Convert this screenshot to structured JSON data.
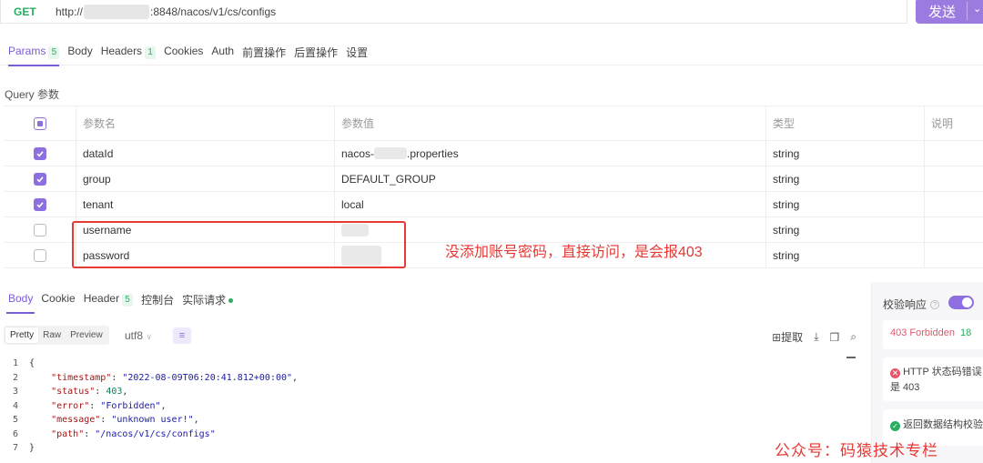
{
  "request": {
    "method": "GET",
    "url_prefix": "http://",
    "url_suffix": ":8848/nacos/v1/cs/configs",
    "send_label": "发送",
    "send_chevron": "⌄"
  },
  "req_tabs": [
    {
      "label": "Params",
      "badge": "5"
    },
    {
      "label": "Body",
      "badge": ""
    },
    {
      "label": "Headers",
      "badge": "1"
    },
    {
      "label": "Cookies",
      "badge": ""
    },
    {
      "label": "Auth",
      "badge": ""
    },
    {
      "label": "前置操作",
      "badge": ""
    },
    {
      "label": "后置操作",
      "badge": ""
    },
    {
      "label": "设置",
      "badge": ""
    }
  ],
  "query_label": "Query 参数",
  "params": {
    "headers": {
      "name": "参数名",
      "value": "参数值",
      "type": "类型",
      "desc": "说明"
    },
    "rows": [
      {
        "checked": true,
        "name": "dataId",
        "value_prefix": "nacos-",
        "value_suffix": ".properties",
        "type": "string"
      },
      {
        "checked": true,
        "name": "group",
        "value_prefix": "DEFAULT_GROUP",
        "value_suffix": "",
        "type": "string"
      },
      {
        "checked": true,
        "name": "tenant",
        "value_prefix": "local",
        "value_suffix": "",
        "type": "string"
      },
      {
        "checked": false,
        "name": "username",
        "value_prefix": "",
        "value_suffix": "",
        "type": "string"
      },
      {
        "checked": false,
        "name": "password",
        "value_prefix": "",
        "value_suffix": "",
        "type": "string"
      }
    ]
  },
  "annotation": "没添加账号密码，直接访问，是会报403",
  "resp_tabs": [
    {
      "label": "Body",
      "badge": ""
    },
    {
      "label": "Cookie",
      "badge": ""
    },
    {
      "label": "Header",
      "badge": "5"
    },
    {
      "label": "控制台",
      "badge": ""
    },
    {
      "label": "实际请求",
      "badge": ""
    }
  ],
  "view_modes": [
    "Pretty",
    "Raw",
    "Preview"
  ],
  "encoding": "utf8",
  "encoding_chevron": "∨",
  "extract_label": "提取",
  "code_lines": [
    {
      "n": "1",
      "parts": [
        [
          "p",
          "{"
        ]
      ]
    },
    {
      "n": "2",
      "parts": [
        [
          "p",
          "    "
        ],
        [
          "k",
          "\"timestamp\""
        ],
        [
          "p",
          ": "
        ],
        [
          "s",
          "\"2022-08-09T06:20:41.812+00:00\""
        ],
        [
          "p",
          ","
        ]
      ]
    },
    {
      "n": "3",
      "parts": [
        [
          "p",
          "    "
        ],
        [
          "k",
          "\"status\""
        ],
        [
          "p",
          ": "
        ],
        [
          "n",
          "403"
        ],
        [
          "p",
          ","
        ]
      ]
    },
    {
      "n": "4",
      "parts": [
        [
          "p",
          "    "
        ],
        [
          "k",
          "\"error\""
        ],
        [
          "p",
          ": "
        ],
        [
          "s",
          "\"Forbidden\""
        ],
        [
          "p",
          ","
        ]
      ]
    },
    {
      "n": "5",
      "parts": [
        [
          "p",
          "    "
        ],
        [
          "k",
          "\"message\""
        ],
        [
          "p",
          ": "
        ],
        [
          "s",
          "\"unknown user!\""
        ],
        [
          "p",
          ","
        ]
      ]
    },
    {
      "n": "6",
      "parts": [
        [
          "p",
          "    "
        ],
        [
          "k",
          "\"path\""
        ],
        [
          "p",
          ": "
        ],
        [
          "s",
          "\"/nacos/v1/cs/configs\""
        ]
      ]
    },
    {
      "n": "7",
      "parts": [
        [
          "p",
          "}"
        ]
      ]
    }
  ],
  "validation": {
    "label": "校验响应",
    "question_mark": "?",
    "status_text": "403 Forbidden",
    "status_num": "18",
    "error_icon": "✕",
    "error_line1": "HTTP 状态码错误",
    "error_line2": "是 403",
    "ok_icon": "✓",
    "ok_text": "返回数据结构校验"
  },
  "watermark": "公众号：码猿技术专栏",
  "colors": {
    "accent": "#8e6fe0",
    "get": "#27ae60",
    "annotation": "#e53935",
    "error": "#e5566a"
  }
}
